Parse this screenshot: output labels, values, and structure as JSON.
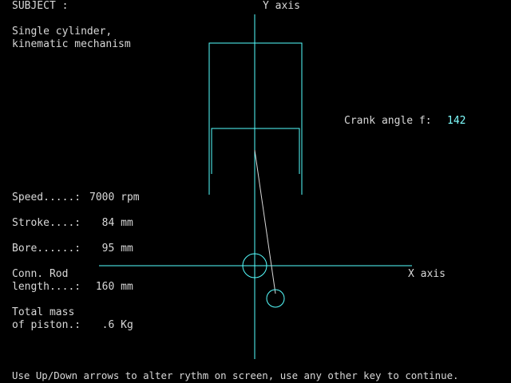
{
  "subject": {
    "heading": "SUBJECT :",
    "line1": "Single cylinder,",
    "line2": "kinematic mechanism"
  },
  "axes": {
    "y_label": "Y axis",
    "x_label": "X axis"
  },
  "crank": {
    "label": "Crank angle f:",
    "value": "142"
  },
  "parameters": {
    "speed": {
      "label": "Speed.....:",
      "value": "7000 rpm"
    },
    "stroke": {
      "label": "Stroke....:",
      "value": "  84 mm"
    },
    "bore": {
      "label": "Bore......:",
      "value": "  95 mm"
    },
    "conn_rod": {
      "label_line1": "Conn. Rod",
      "label_line2": "length....:",
      "value": " 160 mm"
    },
    "mass": {
      "label_line1": "Total mass",
      "label_line2": "of piston.:",
      "value": "  .6 Kg"
    }
  },
  "footer": {
    "instruction": "Use Up/Down arrows to alter rythm on screen, use any other key to continue."
  },
  "colors": {
    "background": "#000000",
    "text": "#d8d8d8",
    "drawing": "#55ffff",
    "crank_value": "#7fffff"
  }
}
